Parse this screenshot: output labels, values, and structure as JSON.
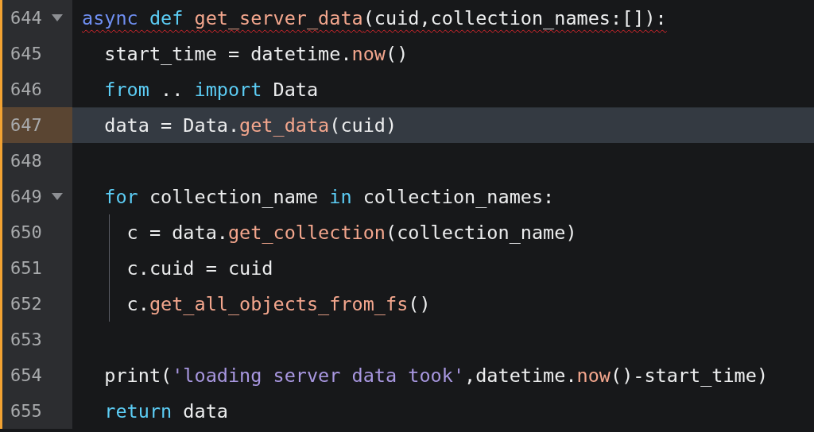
{
  "lines": [
    {
      "number": "644",
      "foldable": true,
      "current": false,
      "error": true,
      "tokens": [
        {
          "kind": "storage",
          "text": "async "
        },
        {
          "kind": "keyword",
          "text": "def "
        },
        {
          "kind": "function",
          "text": "get_server_data"
        },
        {
          "kind": "plain",
          "text": "(cuid,collection_names:[]):"
        }
      ],
      "children": [
        {
          "number": "645",
          "foldable": false,
          "current": false,
          "tokens": [
            {
              "kind": "plain",
              "text": "start_time = datetime."
            },
            {
              "kind": "function",
              "text": "now"
            },
            {
              "kind": "plain",
              "text": "()"
            }
          ]
        },
        {
          "number": "646",
          "foldable": false,
          "current": false,
          "tokens": [
            {
              "kind": "keyword",
              "text": "from"
            },
            {
              "kind": "plain",
              "text": " .. "
            },
            {
              "kind": "keyword",
              "text": "import"
            },
            {
              "kind": "plain",
              "text": " Data"
            }
          ]
        },
        {
          "number": "647",
          "foldable": false,
          "current": true,
          "tokens": [
            {
              "kind": "plain",
              "text": "data = Data."
            },
            {
              "kind": "function",
              "text": "get_data"
            },
            {
              "kind": "plain",
              "text": "(cuid)"
            }
          ]
        },
        {
          "number": "648",
          "foldable": false,
          "current": false
        },
        {
          "number": "649",
          "foldable": true,
          "current": false,
          "tokens": [
            {
              "kind": "keyword",
              "text": "for"
            },
            {
              "kind": "plain",
              "text": " collection_name "
            },
            {
              "kind": "keyword",
              "text": "in"
            },
            {
              "kind": "plain",
              "text": " collection_names:"
            }
          ],
          "children": [
            {
              "number": "650",
              "foldable": false,
              "current": false,
              "tokens": [
                {
                  "kind": "plain",
                  "text": "c = data."
                },
                {
                  "kind": "function",
                  "text": "get_collection"
                },
                {
                  "kind": "plain",
                  "text": "(collection_name)"
                }
              ]
            },
            {
              "number": "651",
              "foldable": false,
              "current": false,
              "tokens": [
                {
                  "kind": "plain",
                  "text": "c.cuid = cuid"
                }
              ]
            },
            {
              "number": "652",
              "foldable": false,
              "current": false,
              "tokens": [
                {
                  "kind": "plain",
                  "text": "c."
                },
                {
                  "kind": "function",
                  "text": "get_all_objects_from_fs"
                },
                {
                  "kind": "plain",
                  "text": "()"
                }
              ]
            }
          ]
        },
        {
          "number": "653",
          "foldable": false,
          "current": false
        },
        {
          "number": "654",
          "foldable": false,
          "current": false,
          "tokens": [
            {
              "kind": "plain",
              "text": "print("
            },
            {
              "kind": "string",
              "text": "'loading server data took'"
            },
            {
              "kind": "plain",
              "text": ",datetime."
            },
            {
              "kind": "function",
              "text": "now"
            },
            {
              "kind": "plain",
              "text": "()-start_time)"
            }
          ]
        },
        {
          "number": "655",
          "foldable": false,
          "current": false,
          "tokens": [
            {
              "kind": "keyword",
              "text": "return"
            },
            {
              "kind": "plain",
              "text": " data"
            }
          ]
        }
      ]
    }
  ]
}
